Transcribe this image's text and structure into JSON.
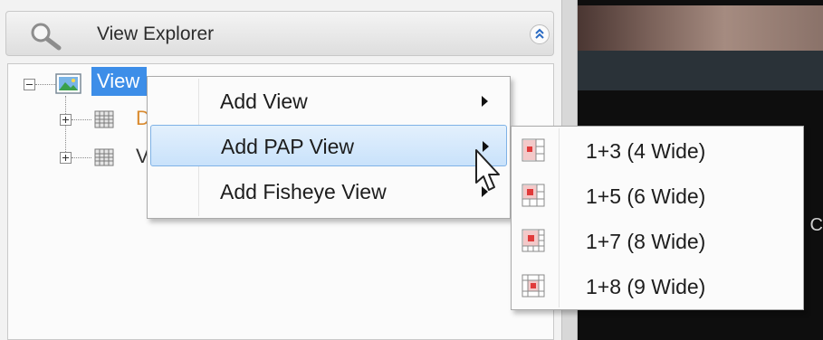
{
  "explorer": {
    "title": "View Explorer",
    "icons": {
      "search": "magnifier-icon",
      "collapse": "double-chevron-up-icon"
    },
    "tree": {
      "root": {
        "label": "View",
        "icon": "view-landscape-icon",
        "expanded": true
      },
      "children": [
        {
          "label": "D",
          "icon": "grid-view-icon",
          "expanded": false
        },
        {
          "label": "V",
          "icon": "grid-view-icon",
          "expanded": false
        }
      ]
    }
  },
  "context_menu": {
    "items": [
      {
        "label": "Add View",
        "has_submenu": true
      },
      {
        "label": "Add PAP View",
        "has_submenu": true,
        "highlighted": true
      },
      {
        "label": "Add Fisheye View",
        "has_submenu": true
      }
    ]
  },
  "submenu": {
    "items": [
      {
        "label": "1+3 (4 Wide)",
        "icon": "layout-1plus3-icon"
      },
      {
        "label": "1+5 (6 Wide)",
        "icon": "layout-1plus5-icon"
      },
      {
        "label": "1+7 (8 Wide)",
        "icon": "layout-1plus7-icon"
      },
      {
        "label": "1+8 (9 Wide)",
        "icon": "layout-1plus8-icon"
      }
    ]
  },
  "video_area": {
    "edge_char": "C"
  },
  "colors": {
    "selection": "#3d8ee8",
    "menu_highlight": "#c9e2fb",
    "accent_red": "#e03a3a"
  }
}
